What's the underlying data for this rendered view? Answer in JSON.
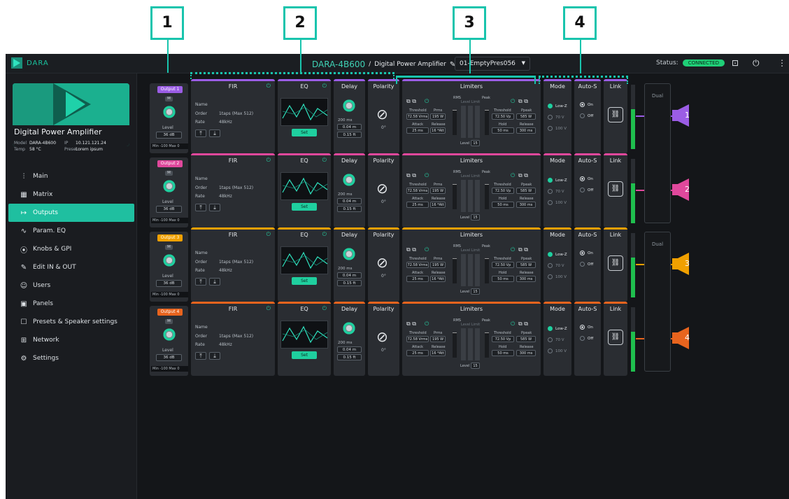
{
  "app": {
    "brand": "DARA",
    "device_model": "DARA-4B600",
    "device_sep": "/",
    "device_type": "Digital Power Amplifier",
    "preset": "01-EmptyPres056",
    "status_label": "Status:",
    "status_value": "CONNECTED",
    "colors": {
      "accent": "#1fcf9f",
      "bg": "#141619",
      "panel": "#2a2d32"
    }
  },
  "callouts": [
    "1",
    "2",
    "3",
    "4"
  ],
  "device_card": {
    "name": "Digital Power Amplifier",
    "model_label": "Model",
    "model_value": "DARA-4B600",
    "ip_label": "IP",
    "ip_value": "10.121.121.24",
    "temp_label": "Temp",
    "temp_value": "58 °C",
    "preset_label": "Preset",
    "preset_value": "Lorem ipsum"
  },
  "menu": [
    {
      "label": "Main",
      "icon": "sliders-icon"
    },
    {
      "label": "Matrix",
      "icon": "grid-icon"
    },
    {
      "label": "Outputs",
      "icon": "output-icon",
      "active": true
    },
    {
      "label": "Param. EQ",
      "icon": "eq-curve-icon"
    },
    {
      "label": "Knobs & GPI",
      "icon": "knobs-icon"
    },
    {
      "label": "Edit IN & OUT",
      "icon": "pencil-icon"
    },
    {
      "label": "Users",
      "icon": "user-icon"
    },
    {
      "label": "Panels",
      "icon": "panel-icon"
    },
    {
      "label": "Presets  & Speaker settings",
      "icon": "preset-icon"
    },
    {
      "label": "Network",
      "icon": "network-icon"
    },
    {
      "label": "Settings",
      "icon": "gear-icon"
    }
  ],
  "headers": {
    "fir": "FIR",
    "eq": "EQ",
    "delay": "Delay",
    "polarity": "Polarity",
    "limiters": "Limiters",
    "mode": "Mode",
    "autos": "Auto-S",
    "link": "Link",
    "dual": "Dual"
  },
  "labels": {
    "mute": "M",
    "level": "Level",
    "minmax": "Min -100  Max 0",
    "fir_name": "Name",
    "fir_order": "Order",
    "fir_rate": "Rate",
    "eq_set": "Set",
    "polarity_deg": "0°",
    "rms": "RMS",
    "peak": "Peak",
    "level_limit": "Level Limit",
    "threshold": "Threshold",
    "prms": "Prms",
    "attack": "Attack",
    "release": "Release",
    "ppeak": "Ppeak",
    "hold": "Hold",
    "lim_level": "Level",
    "mode_lowz": "Low-Z",
    "mode_70": "70 V",
    "mode_100": "100 V",
    "autos_on": "On",
    "autos_off": "Off"
  },
  "outputs": [
    {
      "label": "Output 1",
      "number": "1",
      "color": "#9b5de5",
      "level": "36 dB",
      "fir_order": "1taps (Max 512)",
      "fir_rate": "48kHz",
      "delay_ms": "200 ms",
      "delay_a": "0.04 m",
      "delay_b": "0.15 ft",
      "rms_threshold": "72.58 Vrms",
      "prms": "195 W",
      "attack": "25 ms",
      "release": "16 *Att",
      "peak_threshold": "72.50 Vp",
      "ppeak": "585 W",
      "hold": "50 ms",
      "peak_release": "300 ms",
      "lim_level": "15",
      "meter_level": 0.62,
      "mode_selected": "Low-Z",
      "autos": "On"
    },
    {
      "label": "Output 2",
      "number": "2",
      "color": "#e0489c",
      "level": "36 dB",
      "fir_order": "1taps (Max 512)",
      "fir_rate": "48kHz",
      "delay_ms": "200 ms",
      "delay_a": "0.04 m",
      "delay_b": "0.15 ft",
      "rms_threshold": "72.58 Vrms",
      "prms": "195 W",
      "attack": "25 ms",
      "release": "16 *Att",
      "peak_threshold": "72.50 Vp",
      "ppeak": "585 W",
      "hold": "50 ms",
      "peak_release": "300 ms",
      "lim_level": "15",
      "meter_level": 0.62,
      "mode_selected": "Low-Z",
      "autos": "On"
    },
    {
      "label": "Output 3",
      "number": "3",
      "color": "#f0a000",
      "level": "36 dB",
      "fir_order": "1taps (Max 512)",
      "fir_rate": "48kHz",
      "delay_ms": "200 ms",
      "delay_a": "0.04 m",
      "delay_b": "0.15 ft",
      "rms_threshold": "72.58 Vrms",
      "prms": "195 W",
      "attack": "25 ms",
      "release": "16 *Att",
      "peak_threshold": "72.50 Vp",
      "ppeak": "585 W",
      "hold": "50 ms",
      "peak_release": "300 ms",
      "lim_level": "15",
      "meter_level": 0.62,
      "mode_selected": "Low-Z",
      "autos": "On"
    },
    {
      "label": "Output 4",
      "number": "4",
      "color": "#e8641e",
      "level": "36 dB",
      "fir_order": "1taps (Max 512)",
      "fir_rate": "48kHz",
      "delay_ms": "200 ms",
      "delay_a": "0.04 m",
      "delay_b": "0.15 ft",
      "rms_threshold": "72.58 Vrms",
      "prms": "195 W",
      "attack": "25 ms",
      "release": "16 *Att",
      "peak_threshold": "72.50 Vp",
      "ppeak": "585 W",
      "hold": "50 ms",
      "peak_release": "300 ms",
      "lim_level": "15",
      "meter_level": 0.62,
      "mode_selected": "Low-Z",
      "autos": "On"
    }
  ]
}
